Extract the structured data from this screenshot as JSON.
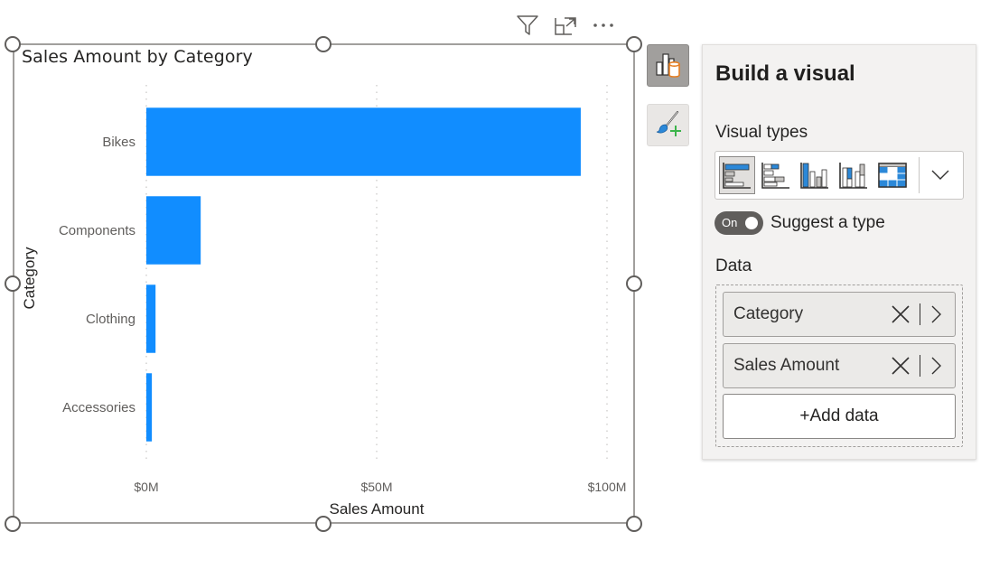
{
  "visual_header": {
    "icons": [
      "filter-icon",
      "focus-mode-icon",
      "more-options-icon"
    ]
  },
  "visual": {
    "title": "Sales Amount by Category"
  },
  "chart_data": {
    "type": "bar",
    "orientation": "horizontal",
    "title": "Sales Amount by Category",
    "xlabel": "Sales Amount",
    "ylabel": "Category",
    "categories": [
      "Bikes",
      "Components",
      "Clothing",
      "Accessories"
    ],
    "values": [
      94.3,
      11.8,
      2.0,
      1.2
    ],
    "value_units": "$M",
    "xlim": [
      0,
      100
    ],
    "xticks": [
      0,
      50,
      100
    ],
    "xtick_labels": [
      "$0M",
      "$50M",
      "$100M"
    ],
    "grid": "vertical dotted",
    "bar_color": "#118dff",
    "legend": "none"
  },
  "side_buttons": {
    "build": "build-visual-icon",
    "format": "format-visual-icon"
  },
  "panel": {
    "title": "Build a visual",
    "visual_types_label": "Visual types",
    "visual_types": [
      {
        "name": "stacked-bar-chart",
        "selected": true
      },
      {
        "name": "clustered-bar-chart",
        "selected": false
      },
      {
        "name": "stacked-column-chart",
        "selected": false
      },
      {
        "name": "clustered-column-chart",
        "selected": false
      },
      {
        "name": "table",
        "selected": false
      }
    ],
    "toggle": {
      "label": "On",
      "state": true,
      "text": "Suggest a type"
    },
    "data_label": "Data",
    "fields": [
      {
        "name": "Category"
      },
      {
        "name": "Sales Amount"
      }
    ],
    "add_data_label": "+Add data"
  },
  "colors": {
    "accent": "#118dff",
    "panel_bg": "#f3f2f1",
    "database_orange": "#e67e22",
    "format_green": "#3bb44a"
  }
}
